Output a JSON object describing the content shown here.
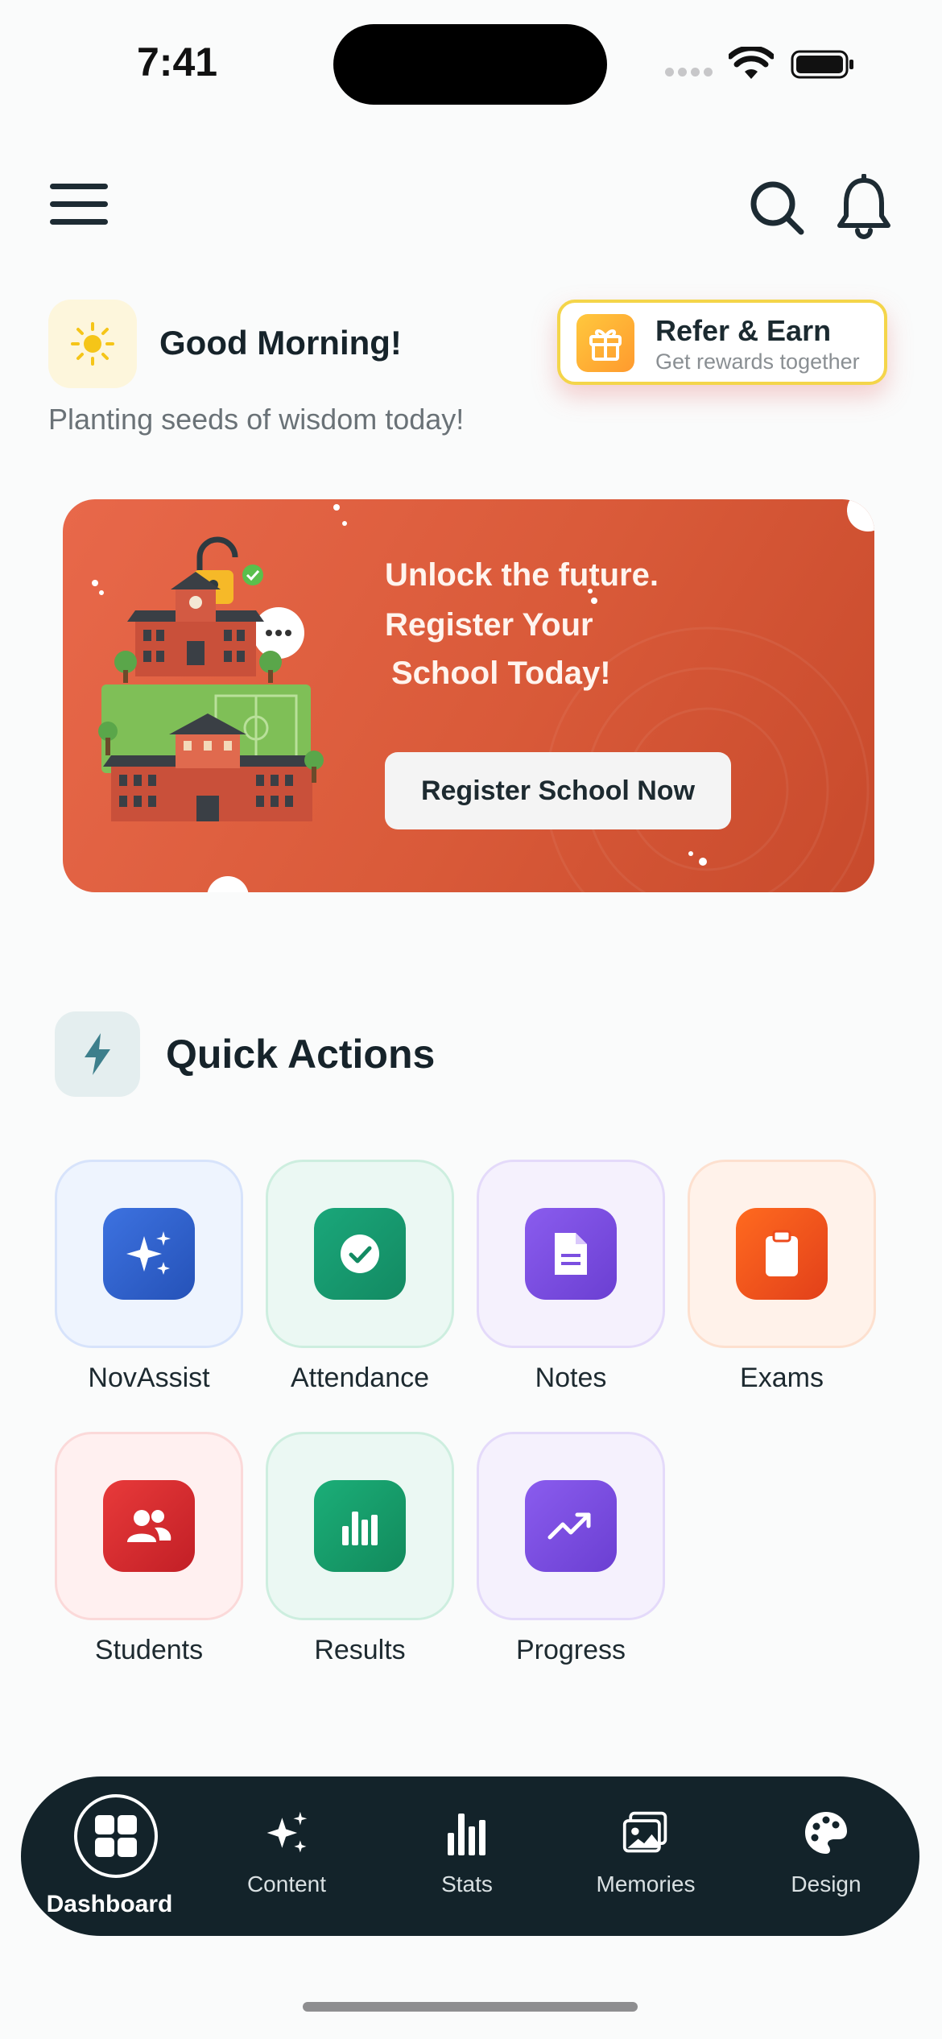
{
  "status_bar": {
    "time": "7:41"
  },
  "header": {
    "menu_icon": "hamburger-icon",
    "search_icon": "search-icon",
    "notification_icon": "bell-icon"
  },
  "greeting": {
    "icon": "sun-icon",
    "title": "Good Morning!",
    "subtitle": "Planting seeds of wisdom today!"
  },
  "refer": {
    "icon": "gift-icon",
    "title": "Refer & Earn",
    "subtitle": "Get rewards together"
  },
  "banner": {
    "lines": [
      "Unlock the future.",
      "Register Your",
      "School Today!"
    ],
    "button_label": "Register School Now",
    "illustration": "school-building-illustration"
  },
  "quick_actions": {
    "title": "Quick Actions",
    "icon": "lightning-icon",
    "items": [
      {
        "label": "NovAssist",
        "icon": "sparkles-icon"
      },
      {
        "label": "Attendance",
        "icon": "check-circle-icon"
      },
      {
        "label": "Notes",
        "icon": "document-icon"
      },
      {
        "label": "Exams",
        "icon": "clipboard-icon"
      },
      {
        "label": "Students",
        "icon": "users-icon"
      },
      {
        "label": "Results",
        "icon": "bar-chart-icon"
      },
      {
        "label": "Progress",
        "icon": "trending-up-icon"
      }
    ]
  },
  "bottom_nav": {
    "active": "Dashboard",
    "items": [
      {
        "label": "Dashboard",
        "icon": "grid-icon"
      },
      {
        "label": "Content",
        "icon": "sparkles-icon"
      },
      {
        "label": "Stats",
        "icon": "bar-chart-icon"
      },
      {
        "label": "Memories",
        "icon": "photo-icon"
      },
      {
        "label": "Design",
        "icon": "palette-icon"
      }
    ]
  },
  "colors": {
    "banner": "#d95a39",
    "nav_background": "#13232a",
    "novassist": "#2f5fd0",
    "attendance": "#169a6e",
    "notes": "#7b4fe0",
    "exams": "#ec4a1c",
    "students": "#d92c2c",
    "results": "#17a26f",
    "progress": "#7e4fe0"
  }
}
